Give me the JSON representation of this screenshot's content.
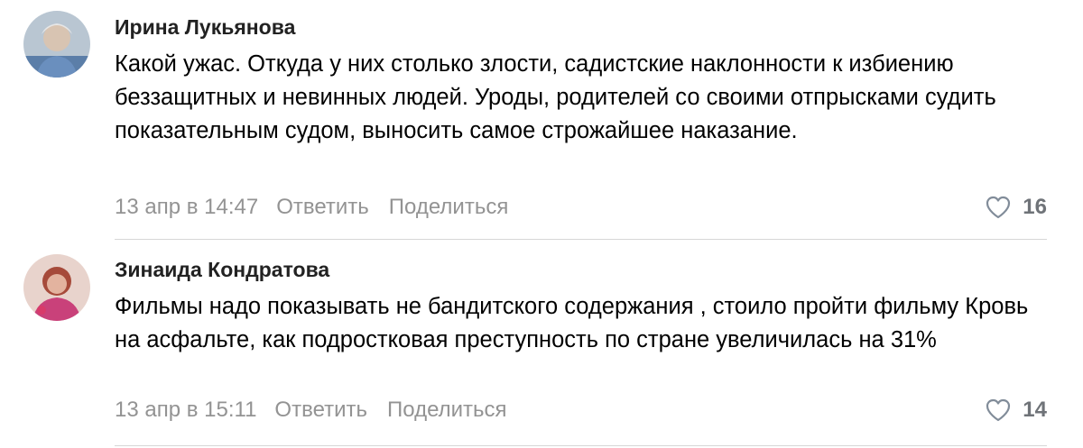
{
  "comments": [
    {
      "author": "Ирина Лукьянова",
      "text": "Какой ужас. Откуда у них столько злости, садистские наклонности к избиению беззащитных и невинных людей. Уроды, родителей со своими отпрысками судить показательным судом, выносить самое строжайшее наказание.",
      "date": "13 апр в 14:47",
      "reply_label": "Ответить",
      "share_label": "Поделиться",
      "likes": "16"
    },
    {
      "author": "Зинаида Кондратова",
      "text": "Фильмы надо показывать не бандитского содержания , стоило пройти фильму Кровь на асфальте, как подростковая преступность по стране увеличилась на 31%",
      "date": "13 апр в 15:11",
      "reply_label": "Ответить",
      "share_label": "Поделиться",
      "likes": "14"
    }
  ],
  "colors": {
    "meta_text": "#939393",
    "like_count": "#6f7378",
    "divider": "#d6d6d6"
  },
  "icons": {
    "like": "heart-outline-icon"
  }
}
